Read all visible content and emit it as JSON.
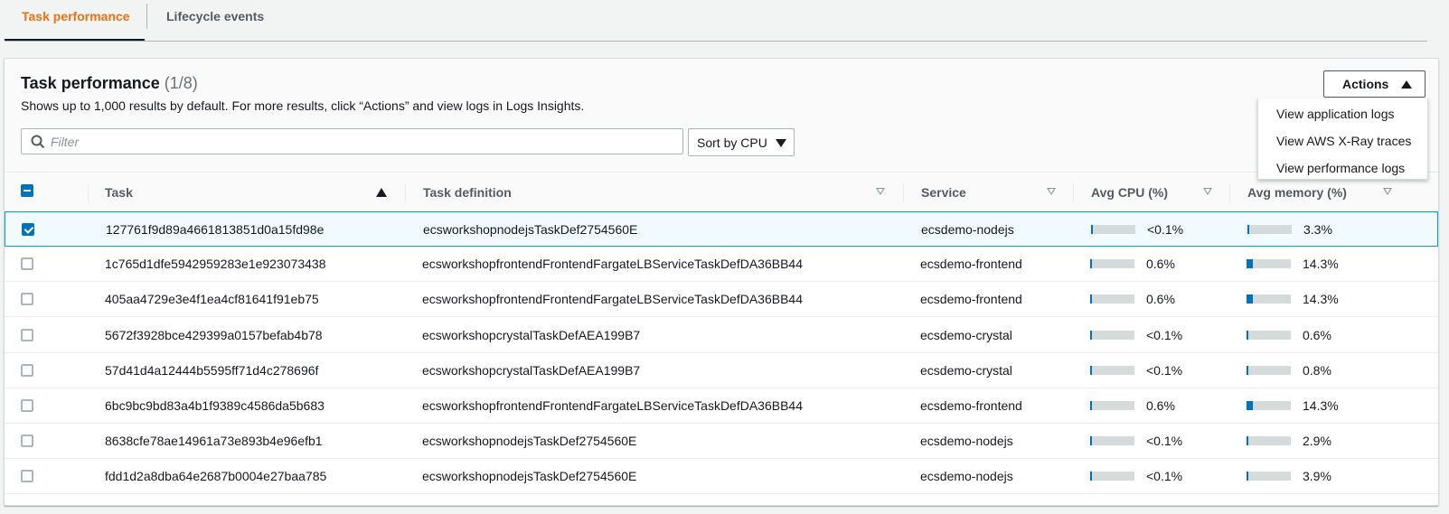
{
  "tabs": [
    {
      "label": "Task performance",
      "active": true
    },
    {
      "label": "Lifecycle events",
      "active": false
    }
  ],
  "panel": {
    "title": "Task performance",
    "count": "(1/8)",
    "description": "Shows up to 1,000 results by default. For more results, click “Actions” and view logs in Logs Insights.",
    "filter_placeholder": "Filter",
    "filter_value": "",
    "sort_label": "Sort by CPU",
    "actions_label": "Actions",
    "actions_menu": [
      "View application logs",
      "View AWS X-Ray traces",
      "View performance logs"
    ]
  },
  "colors": {
    "accent": "#ec7211",
    "primary": "#0073bb",
    "selected_border": "#00a1c9"
  },
  "table": {
    "columns": [
      "Task",
      "Task definition",
      "Service",
      "Avg CPU (%)",
      "Avg memory (%)"
    ],
    "sorted_column": "Task",
    "sort_direction": "ascending",
    "rows": [
      {
        "selected": true,
        "task": "127761f9d89a4661813851d0a15fd98e",
        "task_definition": "ecsworkshopnodejsTaskDef2754560E",
        "service": "ecsdemo-nodejs",
        "cpu": "<0.1%",
        "cpu_value": 0.1,
        "memory": "3.3%",
        "memory_value": 3.3
      },
      {
        "selected": false,
        "task": "1c765d1dfe5942959283e1e923073438",
        "task_definition": "ecsworkshopfrontendFrontendFargateLBServiceTaskDefDA36BB44",
        "service": "ecsdemo-frontend",
        "cpu": "0.6%",
        "cpu_value": 0.6,
        "memory": "14.3%",
        "memory_value": 14.3
      },
      {
        "selected": false,
        "task": "405aa4729e3e4f1ea4cf81641f91eb75",
        "task_definition": "ecsworkshopfrontendFrontendFargateLBServiceTaskDefDA36BB44",
        "service": "ecsdemo-frontend",
        "cpu": "0.6%",
        "cpu_value": 0.6,
        "memory": "14.3%",
        "memory_value": 14.3
      },
      {
        "selected": false,
        "task": "5672f3928bce429399a0157befab4b78",
        "task_definition": "ecsworkshopcrystalTaskDefAEA199B7",
        "service": "ecsdemo-crystal",
        "cpu": "<0.1%",
        "cpu_value": 0.1,
        "memory": "0.6%",
        "memory_value": 0.6
      },
      {
        "selected": false,
        "task": "57d41d4a12444b5595ff71d4c278696f",
        "task_definition": "ecsworkshopcrystalTaskDefAEA199B7",
        "service": "ecsdemo-crystal",
        "cpu": "<0.1%",
        "cpu_value": 0.1,
        "memory": "0.8%",
        "memory_value": 0.8
      },
      {
        "selected": false,
        "task": "6bc9bc9bd83a4b1f9389c4586da5b683",
        "task_definition": "ecsworkshopfrontendFrontendFargateLBServiceTaskDefDA36BB44",
        "service": "ecsdemo-frontend",
        "cpu": "0.6%",
        "cpu_value": 0.6,
        "memory": "14.3%",
        "memory_value": 14.3
      },
      {
        "selected": false,
        "task": "8638cfe78ae14961a73e893b4e96efb1",
        "task_definition": "ecsworkshopnodejsTaskDef2754560E",
        "service": "ecsdemo-nodejs",
        "cpu": "<0.1%",
        "cpu_value": 0.1,
        "memory": "2.9%",
        "memory_value": 2.9
      },
      {
        "selected": false,
        "task": "fdd1d2a8dba64e2687b0004e27baa785",
        "task_definition": "ecsworkshopnodejsTaskDef2754560E",
        "service": "ecsdemo-nodejs",
        "cpu": "<0.1%",
        "cpu_value": 0.1,
        "memory": "3.9%",
        "memory_value": 3.9
      }
    ]
  }
}
